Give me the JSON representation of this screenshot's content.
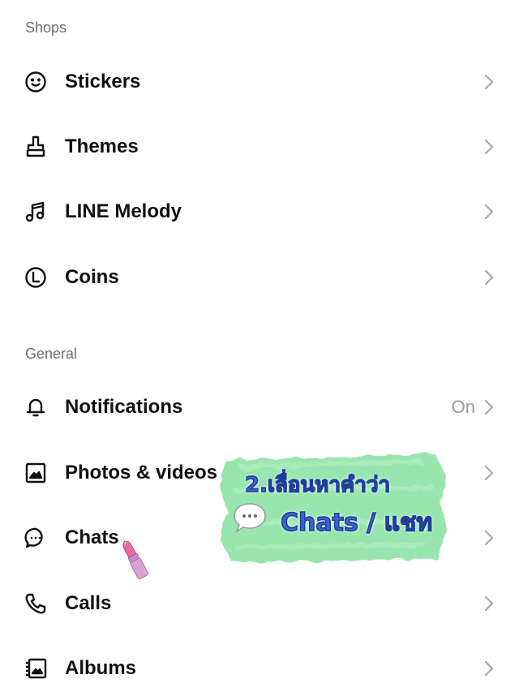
{
  "sections": {
    "shops": {
      "header": "Shops",
      "items": [
        {
          "label": "Stickers",
          "icon": "smiley-icon"
        },
        {
          "label": "Themes",
          "icon": "brush-icon"
        },
        {
          "label": "LINE Melody",
          "icon": "music-note-icon"
        },
        {
          "label": "Coins",
          "icon": "coin-icon"
        }
      ]
    },
    "general": {
      "header": "General",
      "items": [
        {
          "label": "Notifications",
          "value": "On",
          "icon": "bell-icon"
        },
        {
          "label": "Photos & videos",
          "icon": "photo-icon"
        },
        {
          "label": "Chats",
          "icon": "chat-bubble-icon"
        },
        {
          "label": "Calls",
          "icon": "phone-icon"
        },
        {
          "label": "Albums",
          "icon": "album-icon"
        }
      ]
    }
  },
  "overlay": {
    "line1": "2.เลื่อนหาคำว่า",
    "line2": "Chats / แชท",
    "highlight_color": "#8fe3a6",
    "text_color": "#3b62c9"
  },
  "colors": {
    "background": "#ffffff",
    "header_text": "#6e6e73",
    "label_text": "#111111",
    "chevron": "#a8a8ad"
  }
}
